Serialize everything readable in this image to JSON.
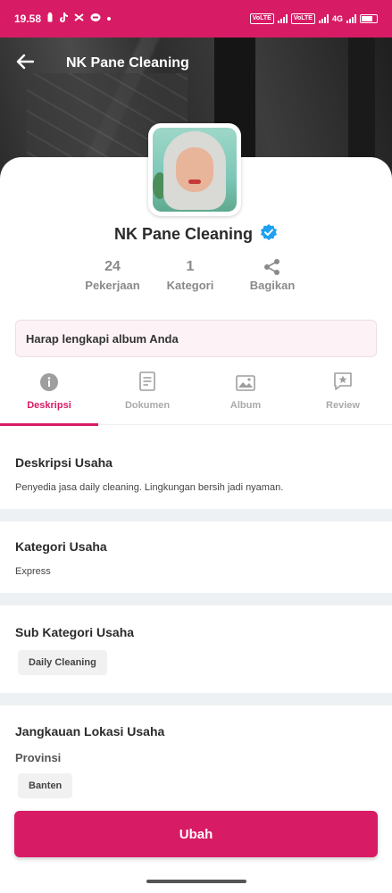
{
  "status_bar": {
    "time": "19.58",
    "network_labels": [
      "VoLTE",
      "VoLTE",
      "4G"
    ]
  },
  "app_bar": {
    "title": "NK Pane Cleaning",
    "back_icon": "arrow-left-icon"
  },
  "profile": {
    "name": "NK Pane Cleaning",
    "verified_icon": "verified-badge-icon",
    "stats": [
      {
        "value": "24",
        "label": "Pekerjaan"
      },
      {
        "value": "1",
        "label": "Kategori"
      }
    ],
    "share_label": "Bagikan"
  },
  "notice": "Harap lengkapi album Anda",
  "tabs": [
    {
      "label": "Deskripsi",
      "icon": "info-icon",
      "active": true
    },
    {
      "label": "Dokumen",
      "icon": "document-icon",
      "active": false
    },
    {
      "label": "Album",
      "icon": "image-icon",
      "active": false
    },
    {
      "label": "Review",
      "icon": "star-comment-icon",
      "active": false
    }
  ],
  "sections": {
    "deskripsi": {
      "title": "Deskripsi Usaha",
      "text": "Penyedia jasa daily cleaning. Lingkungan bersih jadi nyaman."
    },
    "kategori": {
      "title": "Kategori Usaha",
      "text": "Express"
    },
    "sub_kategori": {
      "title": "Sub Kategori Usaha",
      "chip": "Daily Cleaning"
    },
    "jangkauan": {
      "title": "Jangkauan Lokasi Usaha",
      "subtitle": "Provinsi",
      "chip": "Banten"
    }
  },
  "button": {
    "label": "Ubah"
  },
  "colors": {
    "accent": "#d81b65",
    "verified": "#1da1f2"
  }
}
